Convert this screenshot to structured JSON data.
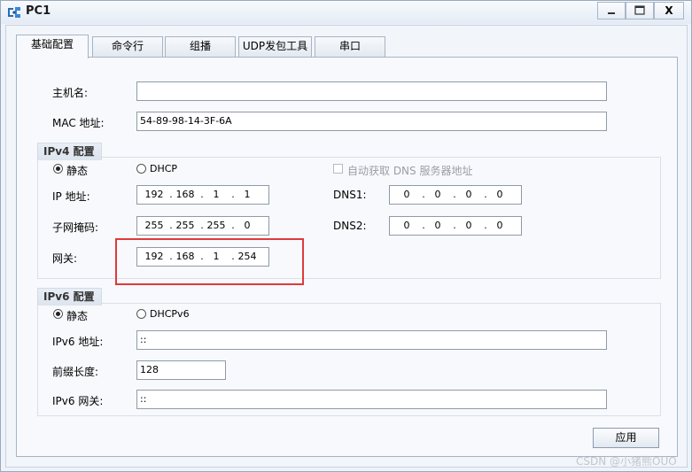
{
  "window": {
    "title": "PC1",
    "app_icon": "network-pc-icon",
    "controls": {
      "minimize": "minimize-icon",
      "maximize": "maximize-icon",
      "close_label": "X"
    }
  },
  "tabs": [
    {
      "label": "基础配置",
      "active": true
    },
    {
      "label": "命令行",
      "active": false
    },
    {
      "label": "组播",
      "active": false
    },
    {
      "label": "UDP发包工具",
      "active": false
    },
    {
      "label": "串口",
      "active": false
    }
  ],
  "basic": {
    "hostname_label": "主机名:",
    "hostname_value": "",
    "mac_label": "MAC 地址:",
    "mac_value": "54-89-98-14-3F-6A"
  },
  "ipv4": {
    "title": "IPv4 配置",
    "static_label": "静态",
    "dhcp_label": "DHCP",
    "mode": "static",
    "auto_dns_label": "自动获取 DNS 服务器地址",
    "auto_dns_checked": false,
    "ip_label": "IP 地址:",
    "ip": [
      "192",
      "168",
      "1",
      "1"
    ],
    "mask_label": "子网掩码:",
    "mask": [
      "255",
      "255",
      "255",
      "0"
    ],
    "gateway_label": "网关:",
    "gateway": [
      "192",
      "168",
      "1",
      "254"
    ],
    "dns1_label": "DNS1:",
    "dns1": [
      "0",
      "0",
      "0",
      "0"
    ],
    "dns2_label": "DNS2:",
    "dns2": [
      "0",
      "0",
      "0",
      "0"
    ]
  },
  "ipv6": {
    "title": "IPv6 配置",
    "static_label": "静态",
    "dhcp_label": "DHCPv6",
    "mode": "static",
    "ip_label": "IPv6 地址:",
    "ip_value": "::",
    "prefix_label": "前缀长度:",
    "prefix_value": "128",
    "gateway_label": "IPv6 网关:",
    "gateway_value": "::"
  },
  "apply_label": "应用",
  "highlight_color": "#e0393a",
  "watermark": "CSDN @小猪熊OUO"
}
